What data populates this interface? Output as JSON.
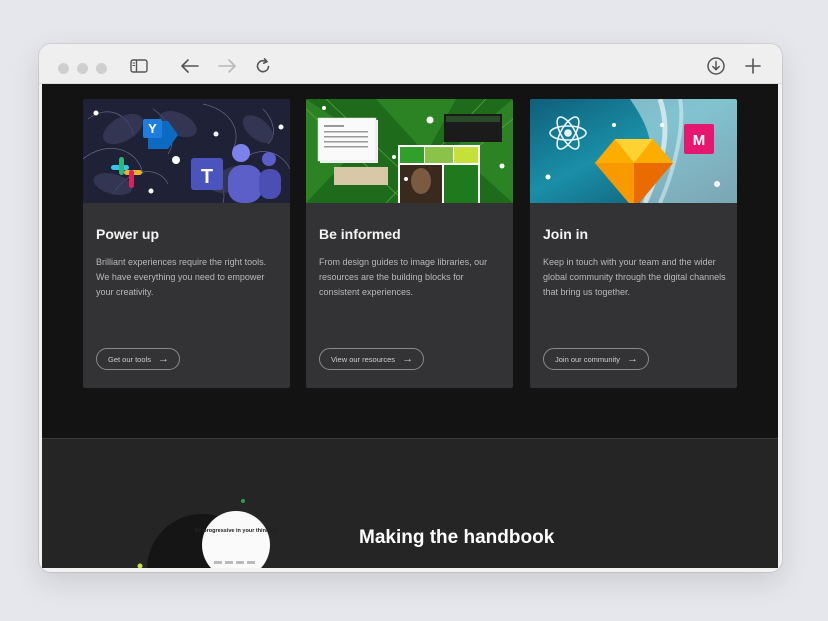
{
  "browser": {
    "icons": {
      "sidebar": "sidebar-toggle-icon",
      "back": "arrow-left-icon",
      "forward": "arrow-right-icon",
      "reload": "reload-icon",
      "download": "download-icon",
      "new_tab": "plus-icon"
    }
  },
  "cards": [
    {
      "title": "Power up",
      "body": "Brilliant experiences require the right tools. We have everything you need to empower your creativity.",
      "cta": "Get our tools",
      "arrow": "→"
    },
    {
      "title": "Be informed",
      "body": "From design guides to image libraries, our resources are the building blocks for consistent experiences.",
      "cta": "View our resources",
      "arrow": "→"
    },
    {
      "title": "Join in",
      "body": "Keep in touch with your team and the wider global community through the digital channels that bring us together.",
      "cta": "Join our community",
      "arrow": "→"
    }
  ],
  "lower": {
    "heading": "Making the handbook",
    "thumb_text": "Be progressive in your thinking"
  },
  "colors": {
    "page_bg": "#111111",
    "card_bg": "#333335",
    "section_bg": "#252525",
    "teams": "#5b5fc7",
    "yammer": "#0b6ac2",
    "sketch": "#f7b500",
    "miro": "#e5176f",
    "react": "#61dafb"
  }
}
